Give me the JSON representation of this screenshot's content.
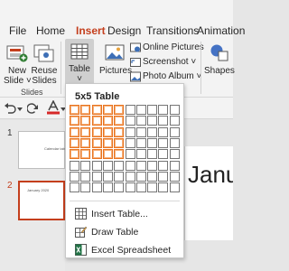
{
  "tabs": [
    "File",
    "Home",
    "Insert",
    "Design",
    "Transitions",
    "Animation"
  ],
  "ribbon": {
    "new_slide_label": "New Slide",
    "new_slide_line1": "New",
    "new_slide_line2": "Slide ˅",
    "reuse_line1": "Reuse",
    "reuse_line2": "Slides",
    "group_slides": "Slides",
    "table_label": "Table",
    "pictures_label": "Pictures",
    "online_pictures": "Online Pictures",
    "screenshot": "Screenshot ˅",
    "photo_album": "Photo Album ˅",
    "shapes_label": "Shapes"
  },
  "table_menu": {
    "title": "5x5 Table",
    "grid_cols": 10,
    "grid_rows": 8,
    "selected_cols": 5,
    "selected_rows": 5,
    "items": [
      "Insert Table...",
      "Draw Table",
      "Excel Spreadsheet"
    ]
  },
  "thumbnails": [
    {
      "number": "1",
      "text": "Calendar tab"
    },
    {
      "number": "2",
      "text": "January 2020"
    }
  ],
  "slide_title": "Janua",
  "colors": {
    "accent": "#c43e1c",
    "highlight": "#e8731f"
  }
}
